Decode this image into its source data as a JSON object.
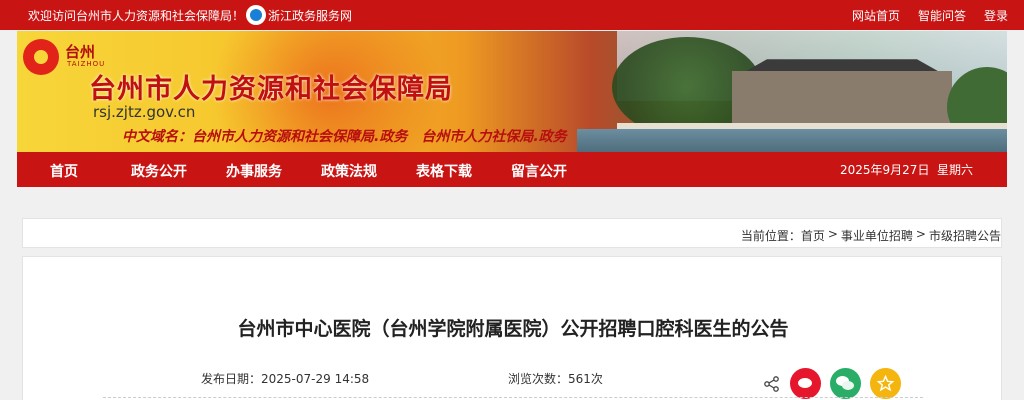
{
  "topbar": {
    "welcome": "欢迎访问台州市人力资源和社会保障局！",
    "zj_service": "浙江政务服务网",
    "links": [
      "网站首页",
      "智能问答",
      "登录"
    ]
  },
  "banner": {
    "logo_cn": "台州",
    "logo_en": "TAIZHOU",
    "title": "台州市人力资源和社会保障局",
    "domain": "rsj.zjtz.gov.cn",
    "cn_domain": "中文域名：台州市人力资源和社会保障局.政务　台州市人力社保局.政务"
  },
  "nav": {
    "items": [
      "首页",
      "政务公开",
      "办事服务",
      "政策法规",
      "表格下载",
      "留言公开"
    ],
    "date": "2025年9月27日",
    "weekday": "星期六"
  },
  "breadcrumb": {
    "label": "当前位置：",
    "items": [
      "首页",
      "事业单位招聘",
      "市级招聘公告"
    ],
    "sep": ">"
  },
  "article": {
    "title": "台州市中心医院（台州学院附属医院）公开招聘口腔科医生的公告",
    "publish": "发布日期：",
    "publish_date": "2025-07-29 14:58",
    "views_label": "浏览次数：",
    "views": "561次"
  },
  "colors": {
    "primary_red": "#c91414",
    "banner_yellow": "#f6c52c"
  },
  "icons": [
    "zj-service-icon",
    "share-icon",
    "weibo-icon",
    "wechat-icon",
    "favorite-icon"
  ]
}
